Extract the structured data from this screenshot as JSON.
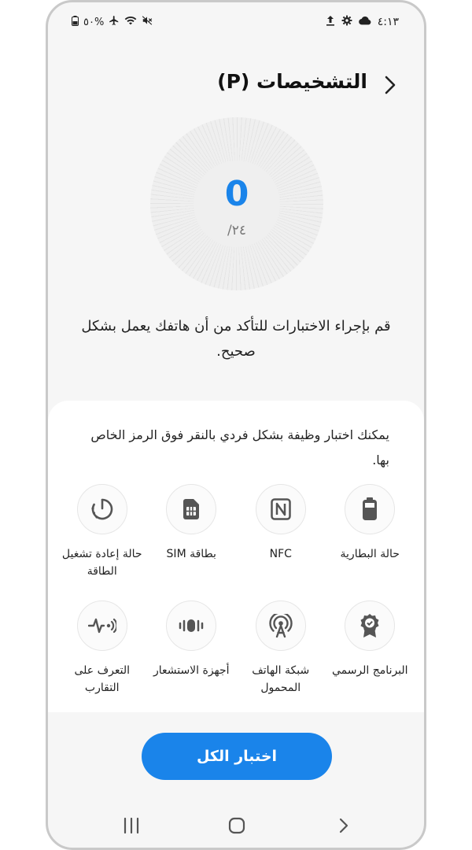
{
  "status_bar": {
    "time": "٤:١٣",
    "battery": "٥٠%"
  },
  "header": {
    "title": "التشخيصات (P)"
  },
  "dial": {
    "count": "0",
    "total": "/٢٤"
  },
  "description": "قم بإجراء الاختبارات للتأكد من أن هاتفك يعمل بشكل صحيح.",
  "card": {
    "text": "يمكنك اختبار وظيفة بشكل فردي بالنقر فوق الرمز الخاص بها."
  },
  "tests": [
    {
      "label": "حالة البطارية",
      "icon": "battery-icon"
    },
    {
      "label": "NFC",
      "icon": "nfc-icon"
    },
    {
      "label": "بطاقة SIM",
      "icon": "sim-card-icon"
    },
    {
      "label": "حالة إعادة تشغيل الطاقة",
      "icon": "power-restart-icon"
    },
    {
      "label": "البرنامج الرسمي",
      "icon": "official-software-icon"
    },
    {
      "label": "شبكة الهاتف المحمول",
      "icon": "mobile-network-icon"
    },
    {
      "label": "أجهزة الاستشعار",
      "icon": "sensors-icon"
    },
    {
      "label": "التعرف على التقارب",
      "icon": "proximity-icon"
    }
  ],
  "test_all_button": "اختبار الكل",
  "colors": {
    "accent": "#1a84ea",
    "background": "#f6f6f6",
    "card": "#ffffff"
  }
}
